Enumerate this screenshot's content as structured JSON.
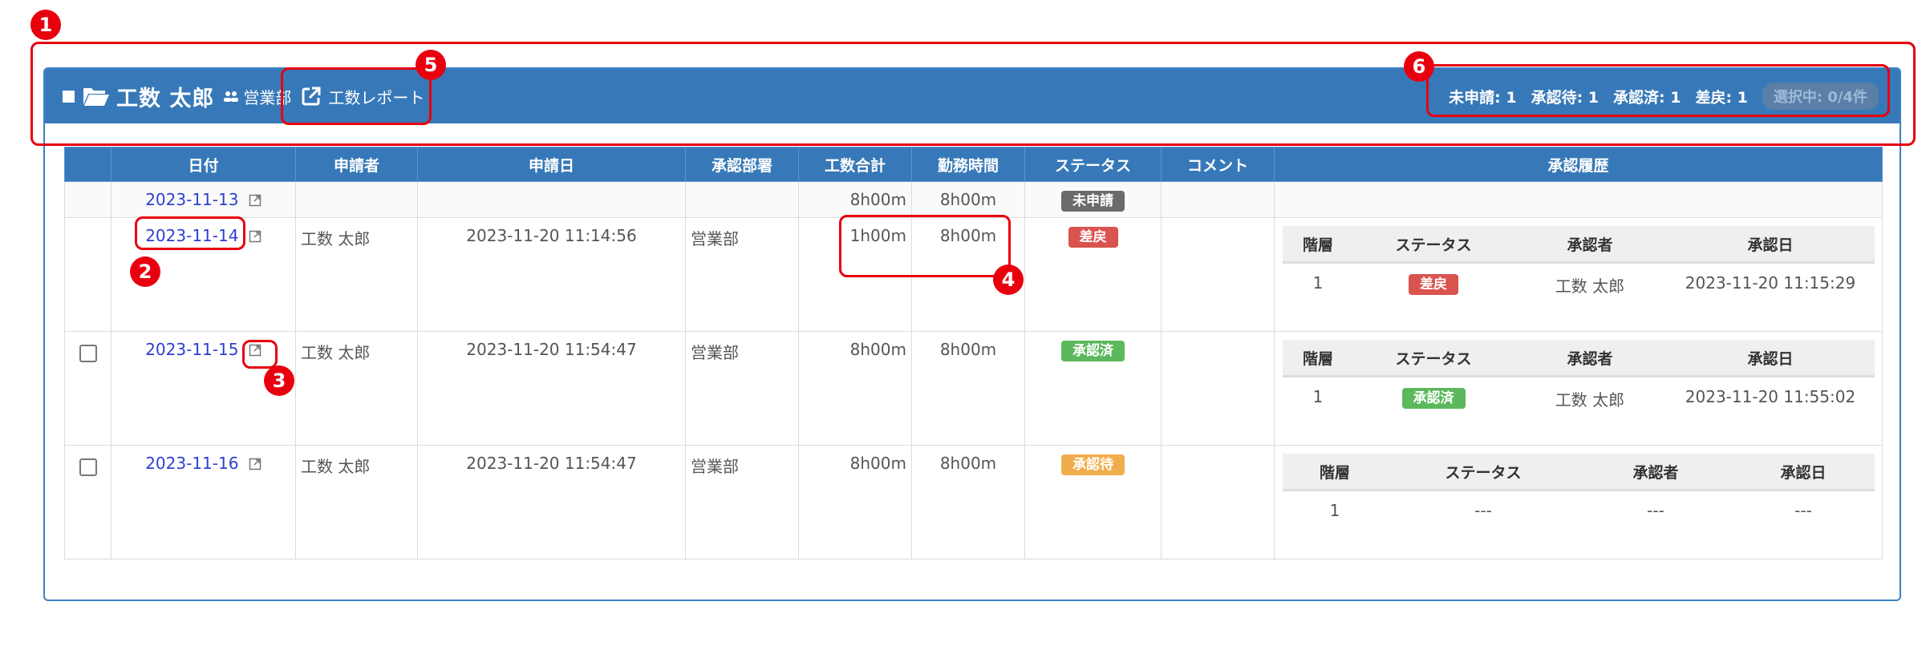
{
  "header": {
    "user_name": "工数 太郎",
    "department": "営業部",
    "report_link": "工数レポート",
    "counts": {
      "unsubmitted": "未申請: 1",
      "pending": "承認待: 1",
      "approved": "承認済: 1",
      "returned": "差戻: 1"
    },
    "selection": "選択中: 0/4件",
    "icons": [
      "square-icon",
      "folder-open-icon",
      "users-icon",
      "external-link-icon"
    ]
  },
  "columns": [
    "日付",
    "申請者",
    "申請日",
    "承認部署",
    "工数合計",
    "勤務時間",
    "ステータス",
    "コメント",
    "承認履歴"
  ],
  "rows": [
    {
      "date": "2023-11-13",
      "applicant": "",
      "applied_at": "",
      "dept": "",
      "total": "8h00m",
      "work": "8h00m",
      "status": "未申請",
      "comment": ""
    },
    {
      "date": "2023-11-14",
      "applicant": "工数 太郎",
      "applied_at": "2023-11-20 11:14:56",
      "dept": "営業部",
      "total": "1h00m",
      "work": "8h00m",
      "status": "差戻",
      "comment": "",
      "history": {
        "headers": [
          "階層",
          "ステータス",
          "承認者",
          "承認日"
        ],
        "row": {
          "level": "1",
          "status": "差戻",
          "approver": "工数 太郎",
          "date": "2023-11-20 11:15:29"
        }
      }
    },
    {
      "date": "2023-11-15",
      "applicant": "工数 太郎",
      "applied_at": "2023-11-20 11:54:47",
      "dept": "営業部",
      "total": "8h00m",
      "work": "8h00m",
      "status": "承認済",
      "comment": "",
      "history": {
        "headers": [
          "階層",
          "ステータス",
          "承認者",
          "承認日"
        ],
        "row": {
          "level": "1",
          "status": "承認済",
          "approver": "工数 太郎",
          "date": "2023-11-20 11:55:02"
        }
      }
    },
    {
      "date": "2023-11-16",
      "applicant": "工数 太郎",
      "applied_at": "2023-11-20 11:54:47",
      "dept": "営業部",
      "total": "8h00m",
      "work": "8h00m",
      "status": "承認待",
      "comment": "",
      "history": {
        "headers": [
          "階層",
          "ステータス",
          "承認者",
          "承認日"
        ],
        "row": {
          "level": "1",
          "status": "---",
          "approver": "---",
          "date": "---"
        }
      }
    }
  ],
  "markers": [
    "1",
    "2",
    "3",
    "4",
    "5",
    "6"
  ],
  "colors": {
    "header_bg": "#3779b8",
    "link": "#2e3fd0",
    "warning_text": "#e0242d",
    "badge_unsubmitted": "#6b6b6b",
    "badge_returned": "#d9534f",
    "badge_approved": "#5cb85c",
    "badge_pending": "#f0ad4e",
    "annotation": "#e8000e"
  }
}
